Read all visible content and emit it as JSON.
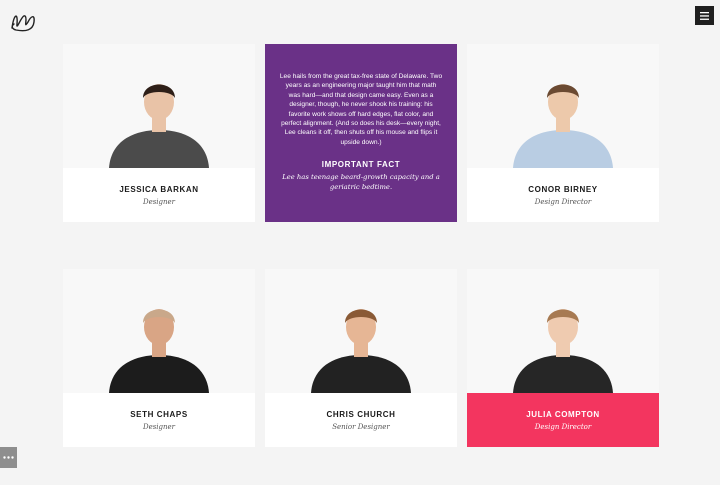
{
  "colors": {
    "page_bg": "#f4f4f4",
    "bio_bg": "#6a3187",
    "highlight": "#f3355f",
    "menu_bg": "#1f1f1f"
  },
  "icons": {
    "logo": "scribble-logo-icon",
    "menu": "hamburger-icon",
    "more": "ellipsis-icon"
  },
  "featured": {
    "bio": "Lee hails from the great tax-free state of Delaware. Two years as an engineering major taught him that math was hard—and that design came easy. Even as a designer, though, he never shook his training: his favorite work shows off hard edges, flat color, and perfect alignment. (And so does his desk—every night, Lee cleans it off, then shuts off his mouse and flips it upside down.)",
    "fact_heading": "IMPORTANT FACT",
    "fact": "Lee has teenage beard-growth capacity and a geriatric bedtime."
  },
  "team": [
    {
      "name": "JESSICA BARKAN",
      "role": "Designer",
      "shirt": "#4b4b4b",
      "hair": "#2e1f18",
      "skin": "#e9c3a7",
      "active": false
    },
    {
      "name": "CONOR BIRNEY",
      "role": "Design Director",
      "shirt": "#b9cde3",
      "hair": "#6b4a32",
      "skin": "#edc9ab",
      "active": false
    },
    {
      "name": "SETH CHAPS",
      "role": "Designer",
      "shirt": "#1c1c1c",
      "hair": "#c9a88a",
      "skin": "#d9a585",
      "active": false
    },
    {
      "name": "CHRIS CHURCH",
      "role": "Senior Designer",
      "shirt": "#222222",
      "hair": "#8a5a36",
      "skin": "#e6b695",
      "active": false
    },
    {
      "name": "JULIA COMPTON",
      "role": "Design Director",
      "shirt": "#262626",
      "hair": "#a77a52",
      "skin": "#efcbb0",
      "active": true
    }
  ]
}
